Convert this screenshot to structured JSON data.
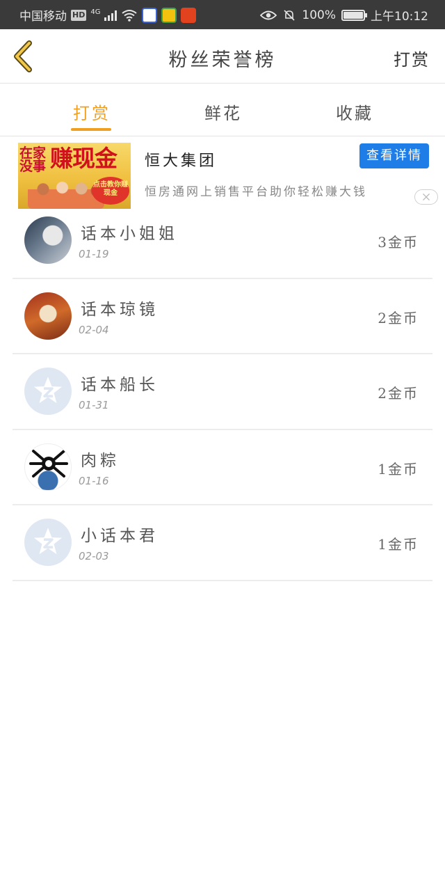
{
  "status_bar": {
    "carrier": "中国移动",
    "hd": "HD",
    "network": "4G",
    "battery": "100%",
    "battery_level": 1.0,
    "time": "上午10:12"
  },
  "header": {
    "title": "粉丝荣誉榜",
    "action_label": "打赏"
  },
  "tabs": [
    {
      "label": "打赏",
      "active": true
    },
    {
      "label": "鲜花",
      "active": false
    },
    {
      "label": "收藏",
      "active": false
    }
  ],
  "ad": {
    "image_text_1": "在家没事",
    "image_text_2": "赚现金",
    "image_badge": "点击教你赚现金",
    "title": "恒大集团",
    "description": "恒房通网上销售平台助你轻松赚大钱",
    "button_label": "查看详情"
  },
  "fans": [
    {
      "name": "话本小姐姐",
      "date": "01-19",
      "coins": "3金币"
    },
    {
      "name": "话本琼镜",
      "date": "02-04",
      "coins": "2金币"
    },
    {
      "name": "话本船长",
      "date": "01-31",
      "coins": "2金币"
    },
    {
      "name": "肉粽",
      "date": "01-16",
      "coins": "1金币"
    },
    {
      "name": "小话本君",
      "date": "02-03",
      "coins": "1金币"
    }
  ],
  "colors": {
    "accent": "#f0a020",
    "ad_button": "#1e7de6",
    "status_bar": "#3a3a3a"
  }
}
